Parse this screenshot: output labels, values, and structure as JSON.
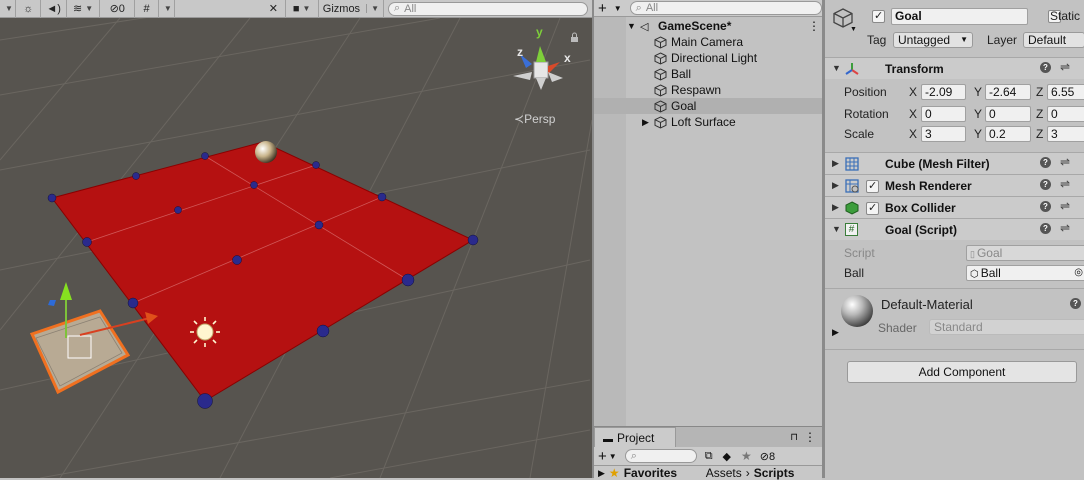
{
  "scene": {
    "toolbar": {
      "shaded_icon": "draw-mode-icon",
      "audio_icon": "speaker-icon",
      "effects_icon": "effects-icon",
      "hidden_count": "0",
      "grid_icon": "grid-icon",
      "tools_icon": "wrench-icon",
      "camera_icon": "camera-icon",
      "gizmos_label": "Gizmos",
      "search_placeholder": "All"
    },
    "gizmo": {
      "y": "y",
      "x": "x",
      "z": "z"
    },
    "persp_label": "Persp",
    "colors": {
      "plane": "#b51111",
      "selection": "#f07020",
      "background": "#57544f"
    }
  },
  "hierarchy": {
    "add_label": "+",
    "search_placeholder": "All",
    "scene_name": "GameScene*",
    "items": [
      {
        "label": "Main Camera",
        "selected": false,
        "expandable": false
      },
      {
        "label": "Directional Light",
        "selected": false,
        "expandable": false
      },
      {
        "label": "Ball",
        "selected": false,
        "expandable": false
      },
      {
        "label": "Respawn",
        "selected": false,
        "expandable": false
      },
      {
        "label": "Goal",
        "selected": true,
        "expandable": false
      },
      {
        "label": "Loft Surface",
        "selected": false,
        "expandable": true
      }
    ]
  },
  "project": {
    "tab_label": "Project",
    "add_label": "+",
    "hidden_count": "8",
    "favorites_label": "Favorites",
    "breadcrumb": [
      "Assets",
      "Scripts"
    ]
  },
  "inspector": {
    "object_name": "Goal",
    "static_label": "Static",
    "tag_label": "Tag",
    "tag_value": "Untagged",
    "layer_label": "Layer",
    "layer_value": "Default",
    "transform": {
      "title": "Transform",
      "position_label": "Position",
      "rotation_label": "Rotation",
      "scale_label": "Scale",
      "axis_x": "X",
      "axis_y": "Y",
      "axis_z": "Z",
      "position": [
        "-2.09",
        "-2.64",
        "6.55"
      ],
      "rotation": [
        "0",
        "0",
        "0"
      ],
      "scale": [
        "3",
        "0.2",
        "3"
      ]
    },
    "components": [
      {
        "title": "Cube (Mesh Filter)",
        "has_checkbox": false
      },
      {
        "title": "Mesh Renderer",
        "has_checkbox": true
      },
      {
        "title": "Box Collider",
        "has_checkbox": true
      }
    ],
    "script_component": {
      "title": "Goal (Script)",
      "script_label": "Script",
      "script_value": "Goal",
      "ball_label": "Ball",
      "ball_value": "Ball"
    },
    "material": {
      "name": "Default-Material",
      "shader_label": "Shader",
      "shader_value": "Standard"
    },
    "add_component_label": "Add Component"
  }
}
